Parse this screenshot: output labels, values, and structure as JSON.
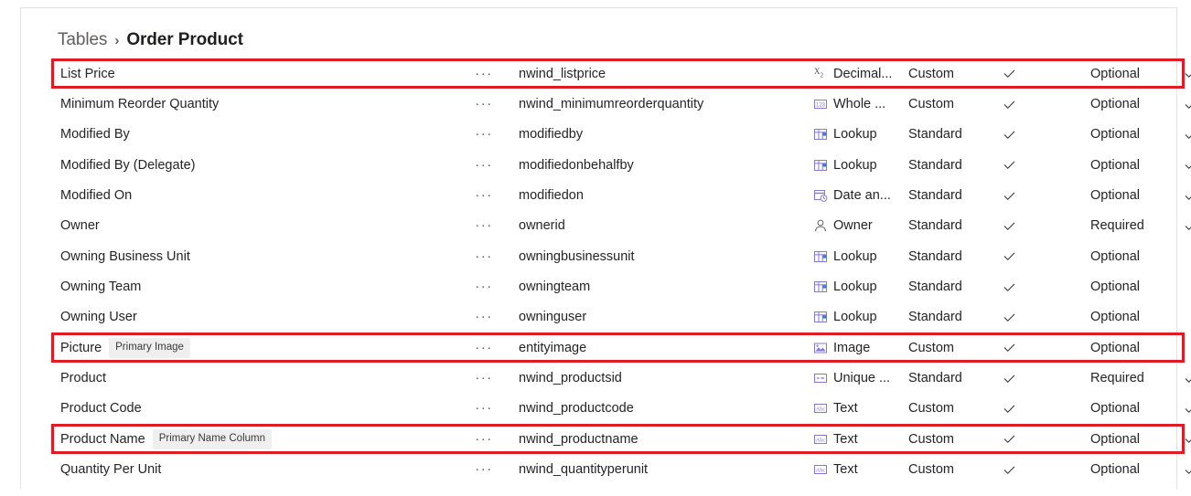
{
  "breadcrumb": {
    "parent": "Tables",
    "separator": "›",
    "current": "Order Product"
  },
  "grid": {
    "ellipsis": "···",
    "rows": [
      {
        "display_name": "List Price",
        "badge": "",
        "logical_name": "nwind_listprice",
        "data_type": "Decimal...",
        "type_icon": "decimal-icon",
        "customization": "Custom",
        "check1": true,
        "requirement": "Optional",
        "check2": true,
        "highlighted": true
      },
      {
        "display_name": "Minimum Reorder Quantity",
        "badge": "",
        "logical_name": "nwind_minimumreorderquantity",
        "data_type": "Whole ...",
        "type_icon": "whole-number-icon",
        "customization": "Custom",
        "check1": true,
        "requirement": "Optional",
        "check2": true,
        "highlighted": false
      },
      {
        "display_name": "Modified By",
        "badge": "",
        "logical_name": "modifiedby",
        "data_type": "Lookup",
        "type_icon": "lookup-icon",
        "customization": "Standard",
        "check1": true,
        "requirement": "Optional",
        "check2": true,
        "highlighted": false
      },
      {
        "display_name": "Modified By (Delegate)",
        "badge": "",
        "logical_name": "modifiedonbehalfby",
        "data_type": "Lookup",
        "type_icon": "lookup-icon",
        "customization": "Standard",
        "check1": true,
        "requirement": "Optional",
        "check2": true,
        "highlighted": false
      },
      {
        "display_name": "Modified On",
        "badge": "",
        "logical_name": "modifiedon",
        "data_type": "Date an...",
        "type_icon": "date-time-icon",
        "customization": "Standard",
        "check1": true,
        "requirement": "Optional",
        "check2": true,
        "highlighted": false
      },
      {
        "display_name": "Owner",
        "badge": "",
        "logical_name": "ownerid",
        "data_type": "Owner",
        "type_icon": "owner-icon",
        "customization": "Standard",
        "check1": true,
        "requirement": "Required",
        "check2": true,
        "highlighted": false
      },
      {
        "display_name": "Owning Business Unit",
        "badge": "",
        "logical_name": "owningbusinessunit",
        "data_type": "Lookup",
        "type_icon": "lookup-icon",
        "customization": "Standard",
        "check1": true,
        "requirement": "Optional",
        "check2": false,
        "highlighted": false
      },
      {
        "display_name": "Owning Team",
        "badge": "",
        "logical_name": "owningteam",
        "data_type": "Lookup",
        "type_icon": "lookup-icon",
        "customization": "Standard",
        "check1": true,
        "requirement": "Optional",
        "check2": false,
        "highlighted": false
      },
      {
        "display_name": "Owning User",
        "badge": "",
        "logical_name": "owninguser",
        "data_type": "Lookup",
        "type_icon": "lookup-icon",
        "customization": "Standard",
        "check1": true,
        "requirement": "Optional",
        "check2": false,
        "highlighted": false
      },
      {
        "display_name": "Picture",
        "badge": "Primary Image",
        "logical_name": "entityimage",
        "data_type": "Image",
        "type_icon": "image-icon",
        "customization": "Custom",
        "check1": true,
        "requirement": "Optional",
        "check2": false,
        "highlighted": true
      },
      {
        "display_name": "Product",
        "badge": "",
        "logical_name": "nwind_productsid",
        "data_type": "Unique ...",
        "type_icon": "unique-identifier-icon",
        "customization": "Standard",
        "check1": true,
        "requirement": "Required",
        "check2": true,
        "highlighted": false
      },
      {
        "display_name": "Product Code",
        "badge": "",
        "logical_name": "nwind_productcode",
        "data_type": "Text",
        "type_icon": "text-icon",
        "customization": "Custom",
        "check1": true,
        "requirement": "Optional",
        "check2": true,
        "highlighted": false
      },
      {
        "display_name": "Product Name",
        "badge": "Primary Name Column",
        "logical_name": "nwind_productname",
        "data_type": "Text",
        "type_icon": "text-icon",
        "customization": "Custom",
        "check1": true,
        "requirement": "Optional",
        "check2": true,
        "highlighted": true
      },
      {
        "display_name": "Quantity Per Unit",
        "badge": "",
        "logical_name": "nwind_quantityperunit",
        "data_type": "Text",
        "type_icon": "text-icon",
        "customization": "Custom",
        "check1": true,
        "requirement": "Optional",
        "check2": true,
        "highlighted": false
      }
    ]
  },
  "colors": {
    "highlight": "#e01b24",
    "icon": "#8378de",
    "text": "#242424",
    "muted": "#605e5c",
    "badge_bg": "#efefef"
  }
}
